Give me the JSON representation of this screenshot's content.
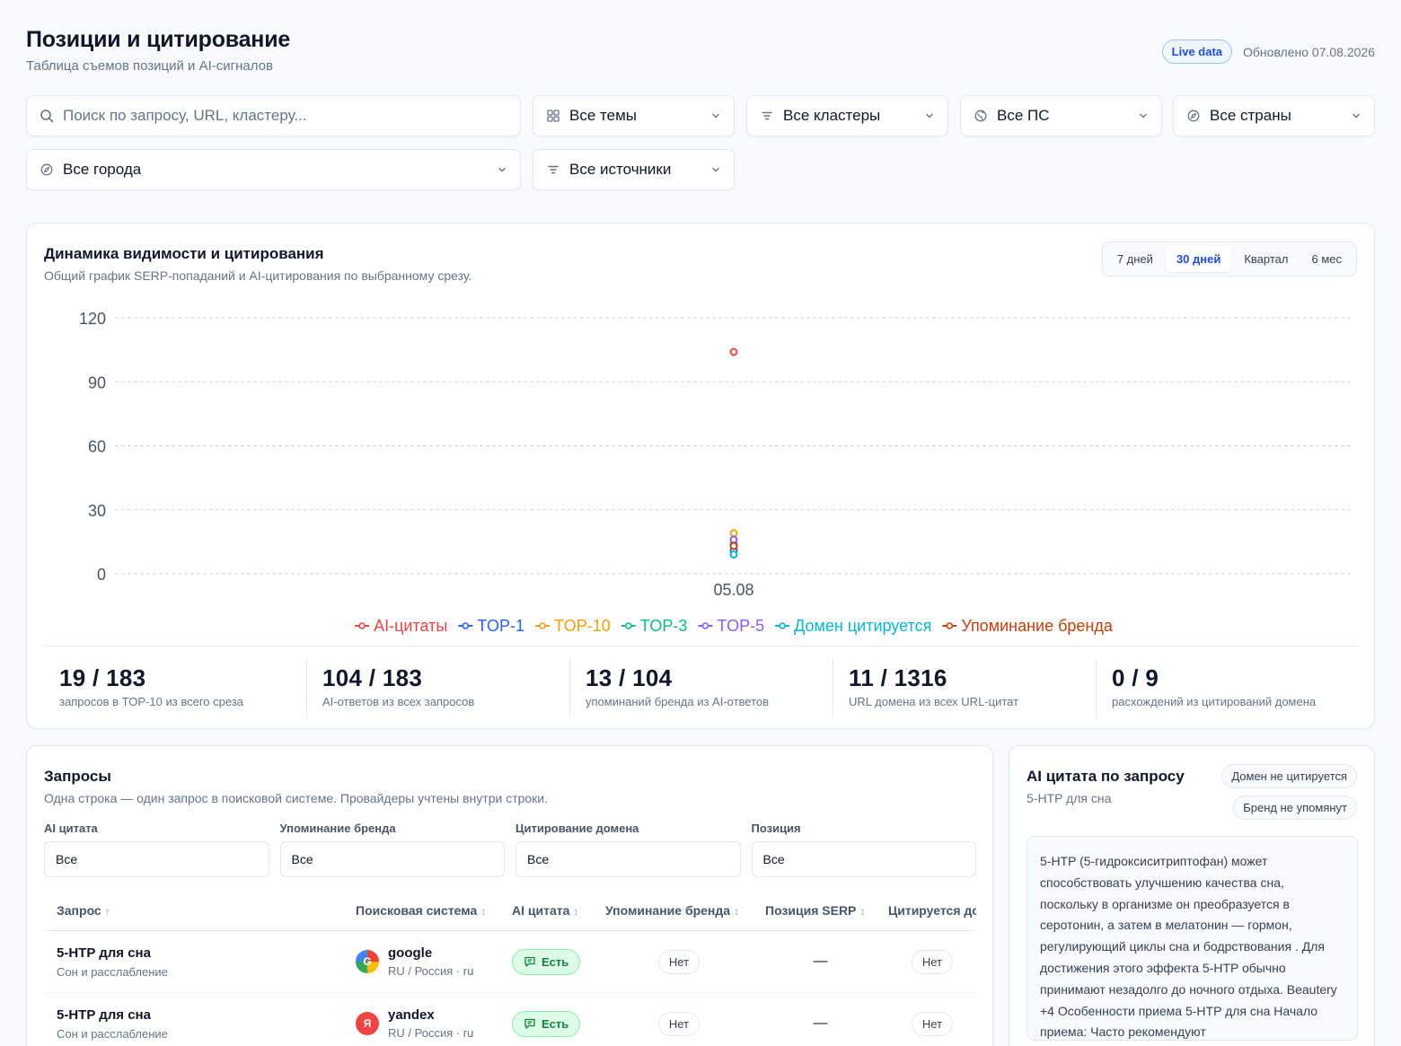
{
  "header": {
    "title": "Позиции и цитирование",
    "subtitle": "Таблица съемов позиций и AI-сигналов",
    "live_badge": "Live data",
    "updated": "Обновлено 07.08.2026"
  },
  "filters": {
    "search_placeholder": "Поиск по запросу, URL, кластеру...",
    "topics": "Все темы",
    "clusters": "Все кластеры",
    "engines": "Все ПС",
    "countries": "Все страны",
    "cities": "Все города",
    "sources": "Все источники"
  },
  "chart_card": {
    "title": "Динамика видимости и цитирования",
    "subtitle": "Общий график SERP-попаданий и AI-цитирования по выбранному срезу.",
    "periods": [
      "7 дней",
      "30 дней",
      "Квартал",
      "6 мес"
    ],
    "active_period": "30 дней"
  },
  "chart_data": {
    "type": "scatter",
    "x": [
      "05.08"
    ],
    "ylim": [
      0,
      120
    ],
    "yticks": [
      0,
      30,
      60,
      90,
      120
    ],
    "grid": true,
    "legend_position": "bottom",
    "series": [
      {
        "name": "AI-цитаты",
        "color": "#ef4444",
        "values": [
          104
        ]
      },
      {
        "name": "TOP-1",
        "color": "#2563eb",
        "values": [
          11
        ]
      },
      {
        "name": "TOP-10",
        "color": "#f59e0b",
        "values": [
          19
        ]
      },
      {
        "name": "TOP-3",
        "color": "#10b981",
        "values": [
          14
        ]
      },
      {
        "name": "TOP-5",
        "color": "#8b5cf6",
        "values": [
          16
        ]
      },
      {
        "name": "Домен цитируется",
        "color": "#06b6d4",
        "values": [
          9
        ]
      },
      {
        "name": "Упоминание бренда",
        "color": "#c2410c",
        "values": [
          13
        ]
      }
    ]
  },
  "stats": [
    {
      "value": "19 / 183",
      "label": "запросов в TOP-10 из всего среза"
    },
    {
      "value": "104 / 183",
      "label": "AI-ответов из всех запросов"
    },
    {
      "value": "13 / 104",
      "label": "упоминаний бренда из AI-ответов"
    },
    {
      "value": "11 / 1316",
      "label": "URL домена из всех URL-цитат"
    },
    {
      "value": "0 / 9",
      "label": "расхождений из цитирований домена"
    }
  ],
  "queries": {
    "title": "Запросы",
    "subtitle": "Одна строка — один запрос в поисковой системе. Провайдеры учтены внутри строки.",
    "filters": [
      {
        "label": "AI цитата",
        "value": "Все"
      },
      {
        "label": "Упоминание бренда",
        "value": "Все"
      },
      {
        "label": "Цитирование домена",
        "value": "Все"
      },
      {
        "label": "Позиция",
        "value": "Все"
      }
    ],
    "columns": [
      "Запрос",
      "Поисковая система",
      "AI цитата",
      "Упоминание бренда",
      "Позиция SERP",
      "Цитируется до"
    ],
    "sort_active": "↑",
    "sort_idle": "↕",
    "rows": [
      {
        "query": "5-HTP для сна",
        "topic": "Сон и расслабление",
        "engine": "google",
        "engine_logo": "G",
        "geo": "RU / Россия · ru",
        "ai": "Есть",
        "brand": "Нет",
        "position": "—",
        "cited": "Нет"
      },
      {
        "query": "5-HTP для сна",
        "topic": "Сон и расслабление",
        "engine": "yandex",
        "engine_logo": "Я",
        "geo": "RU / Россия · ru",
        "ai": "Есть",
        "brand": "Нет",
        "position": "—",
        "cited": "Нет"
      }
    ]
  },
  "ai_panel": {
    "title": "AI цитата по запросу",
    "query": "5-HTP для сна",
    "badge_domain": "Домен не цитируется",
    "badge_brand": "Бренд не упомянут",
    "text": "5-HTP (5-гидроксиситриптофан) может способствовать улучшению качества сна, поскольку в организме он преобразуется в серотонин, а затем в мелатонин — гормон, регулирующий циклы сна и бодрствования . Для достижения этого эффекта 5-HTP обычно принимают незадолго до ночного отдыха. Beautery +4 Особенности приема 5-HTP для сна Начало приема: Часто рекомендуют"
  }
}
